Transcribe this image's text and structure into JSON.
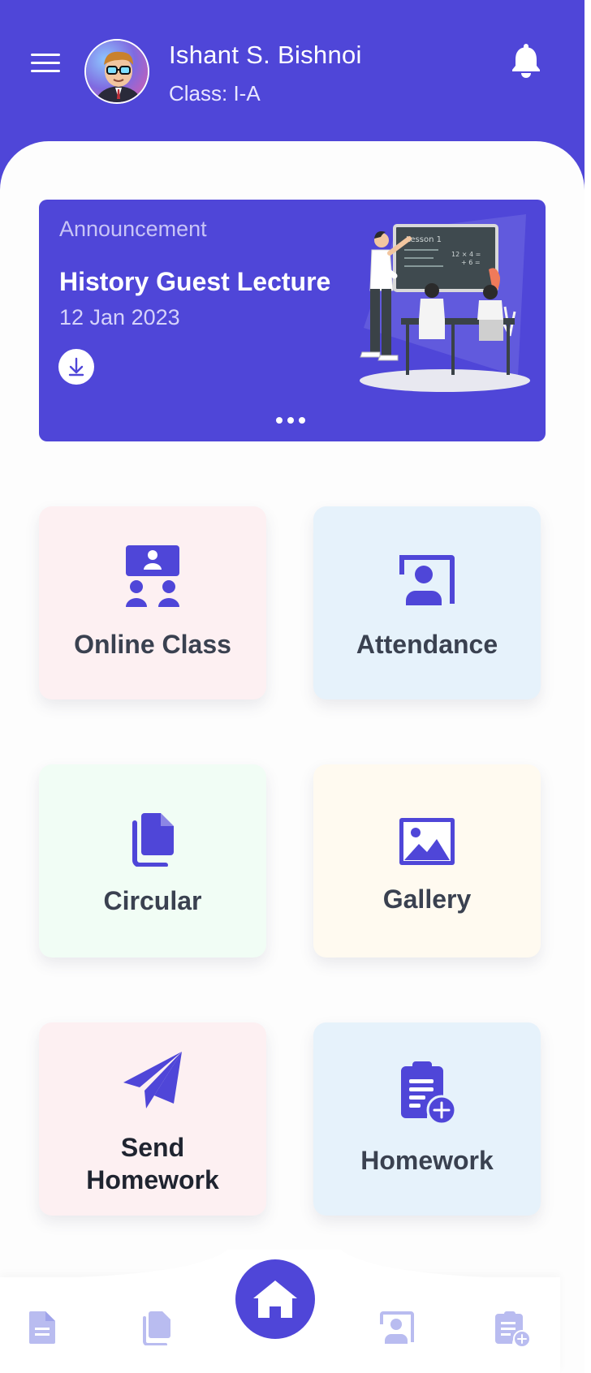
{
  "header": {
    "user_name": "Ishant S. Bishnoi",
    "user_class": "Class: I-A"
  },
  "announcement": {
    "label": "Announcement",
    "title": "History Guest Lecture",
    "date": "12 Jan 2023",
    "board_text": "Lesson 1",
    "board_math": "12 × 4 =",
    "board_math2": "+ 6 ="
  },
  "tiles": [
    {
      "label": "Online Class",
      "icon": "online-class-icon"
    },
    {
      "label": "Attendance",
      "icon": "attendance-icon"
    },
    {
      "label": "Circular",
      "icon": "circular-icon"
    },
    {
      "label": "Gallery",
      "icon": "gallery-icon"
    },
    {
      "label_line1": "Send",
      "label_line2": "Homework",
      "icon": "send-icon"
    },
    {
      "label": "Homework",
      "icon": "homework-icon"
    }
  ],
  "bottom_nav": [
    "document-icon",
    "files-icon",
    "home-icon",
    "attendance-icon",
    "homework-icon"
  ],
  "colors": {
    "primary": "#4f46d8",
    "nav_inactive": "#b9bcf0",
    "tile_pink": "#fdf0f2",
    "tile_blue": "#e6f2fb",
    "tile_green": "#f1fdf5",
    "tile_cream": "#fffaf0"
  }
}
